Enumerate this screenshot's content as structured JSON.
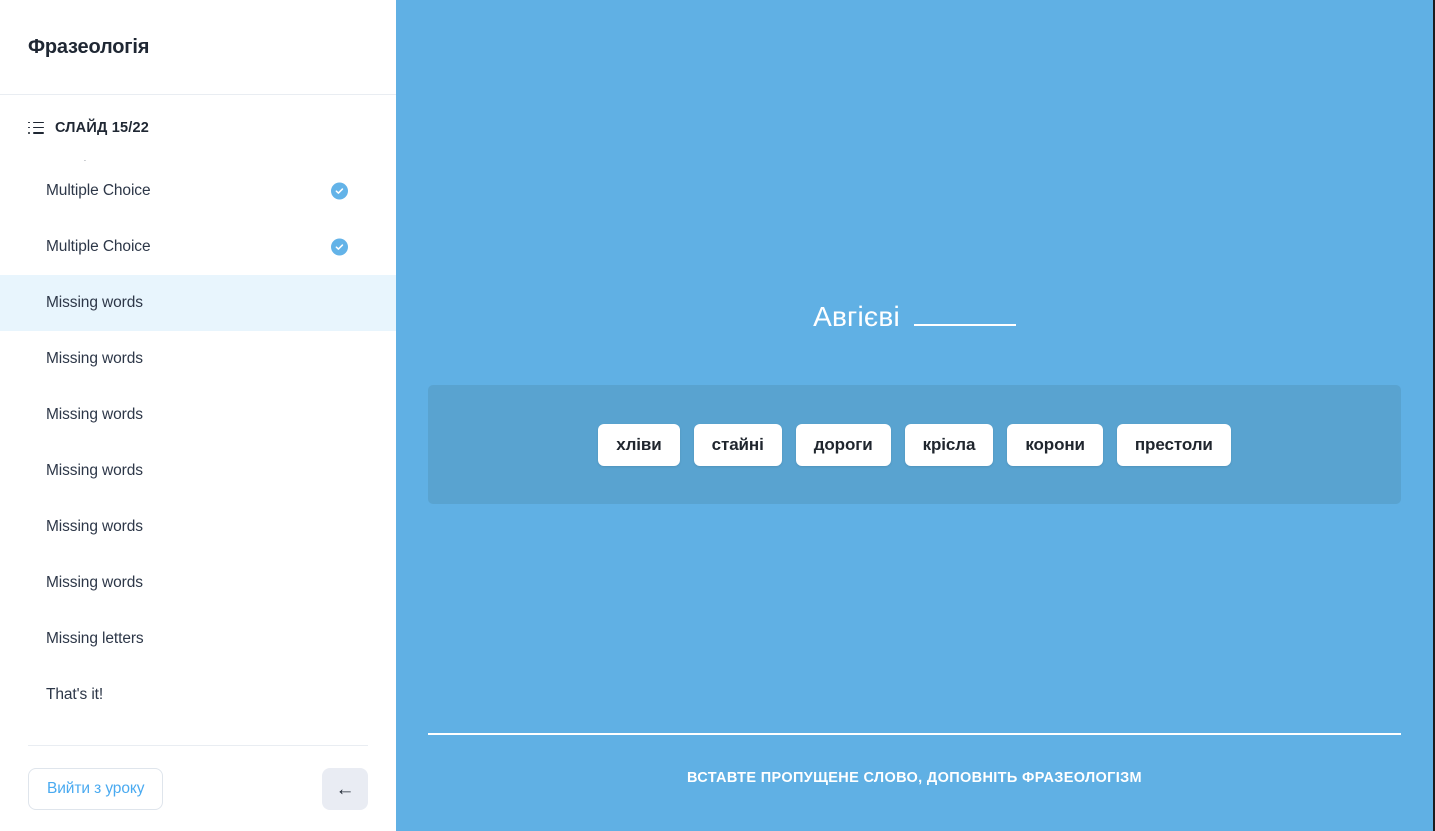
{
  "sidebar": {
    "title": "Фразеологія",
    "slide_counter": {
      "icon": "list-icon",
      "label": "СЛАЙД 15/22"
    },
    "artifact_text": ".",
    "items": [
      {
        "label": "Multiple Choice",
        "completed": true,
        "active": false
      },
      {
        "label": "Multiple Choice",
        "completed": true,
        "active": false
      },
      {
        "label": "Missing words",
        "completed": false,
        "active": true
      },
      {
        "label": "Missing words",
        "completed": false,
        "active": false
      },
      {
        "label": "Missing words",
        "completed": false,
        "active": false
      },
      {
        "label": "Missing words",
        "completed": false,
        "active": false
      },
      {
        "label": "Missing words",
        "completed": false,
        "active": false
      },
      {
        "label": "Missing words",
        "completed": false,
        "active": false
      },
      {
        "label": "Missing letters",
        "completed": false,
        "active": false
      },
      {
        "label": "That's it!",
        "completed": false,
        "active": false
      }
    ],
    "footer": {
      "exit_label": "Вийти з уроку",
      "back_icon": "←"
    }
  },
  "slide": {
    "question_prefix": "Авгієві",
    "blank": "",
    "word_bank": [
      "хліви",
      "стайні",
      "дороги",
      "крісла",
      "корони",
      "престоли"
    ],
    "instruction": "ВСТАВТЕ ПРОПУЩЕНЕ СЛОВО, ДОПОВНІТЬ ФРАЗЕОЛОГІЗМ"
  },
  "colors": {
    "stage_background": "#60b0e4",
    "word_bank_background": "#59a3d0",
    "accent_blue": "#4aaaf0",
    "check_badge": "#63b3e8",
    "active_item": "#e8f5fd",
    "text_dark": "#2d3748"
  }
}
